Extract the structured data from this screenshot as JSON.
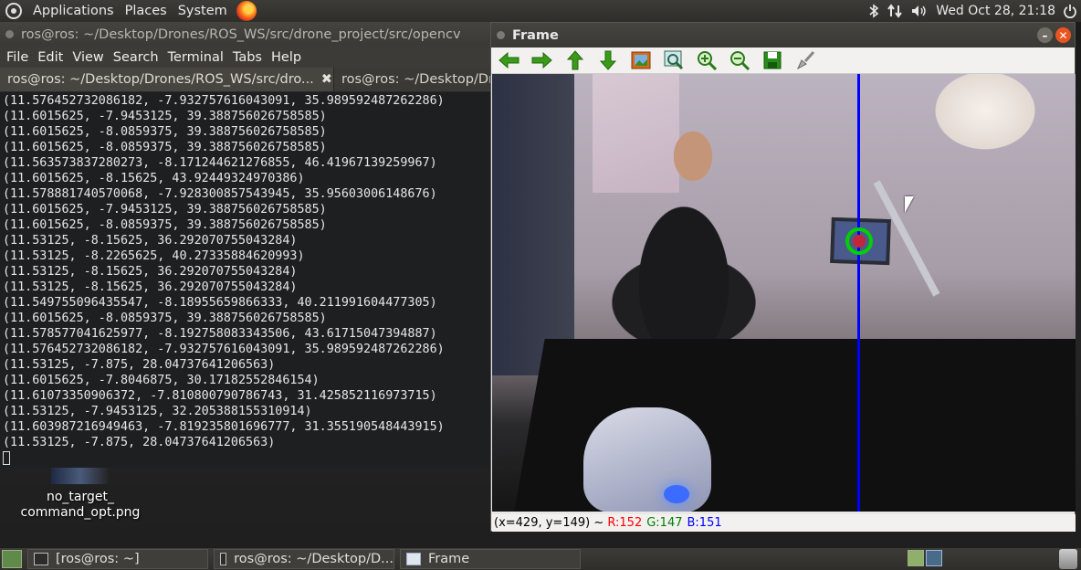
{
  "top_panel": {
    "menus": [
      "Applications",
      "Places",
      "System"
    ],
    "datetime": "Wed Oct 28, 21:18"
  },
  "terminal": {
    "title": "ros@ros: ~/Desktop/Drones/ROS_WS/src/drone_project/src/opencv",
    "menu": [
      "File",
      "Edit",
      "View",
      "Search",
      "Terminal",
      "Tabs",
      "Help"
    ],
    "tabs": [
      {
        "label": "ros@ros: ~/Desktop/Drones/ROS_WS/src/dro...",
        "active": true
      },
      {
        "label": "ros@ros: ~/Desktop/Dr",
        "active": false
      }
    ],
    "lines": [
      "(11.576452732086182, -7.932757616043091, 35.989592487262286)",
      "(11.6015625, -7.9453125, 39.388756026758585)",
      "(11.6015625, -8.0859375, 39.388756026758585)",
      "(11.6015625, -8.0859375, 39.388756026758585)",
      "(11.563573837280273, -8.171244621276855, 46.41967139259967)",
      "(11.6015625, -8.15625, 43.92449324970386)",
      "(11.578881740570068, -7.928300857543945, 35.95603006148676)",
      "(11.6015625, -7.9453125, 39.388756026758585)",
      "(11.6015625, -8.0859375, 39.388756026758585)",
      "(11.53125, -8.15625, 36.292070755043284)",
      "(11.53125, -8.2265625, 40.27335884620993)",
      "(11.53125, -8.15625, 36.292070755043284)",
      "(11.53125, -8.15625, 36.292070755043284)",
      "(11.549755096435547, -8.18955659866333, 40.211991604477305)",
      "(11.6015625, -8.0859375, 39.388756026758585)",
      "(11.578577041625977, -8.192758083343506, 43.61715047394887)",
      "(11.576452732086182, -7.932757616043091, 35.989592487262286)",
      "(11.53125, -7.875, 28.04737641206563)",
      "(11.6015625, -7.8046875, 30.17182552846154)",
      "(11.61073350906372, -7.810800790786743, 31.425852116973715)",
      "(11.53125, -7.9453125, 32.205388155310914)",
      "(11.603987216949463, -7.819235801696777, 31.355190548443915)",
      "(11.53125, -7.875, 28.04737641206563)"
    ]
  },
  "desktop_icon": {
    "line1": "no_target_",
    "line2": "command_opt.png"
  },
  "frame_window": {
    "title": "Frame",
    "status": {
      "coords": "(x=429, y=149)",
      "sep": " ~ ",
      "r": "R:152",
      "g": "G:147",
      "b": "B:151"
    }
  },
  "taskbar": {
    "tasks": [
      "[ros@ros: ~]",
      "ros@ros: ~/Desktop/D...",
      "Frame"
    ]
  },
  "colors": {
    "accent": "#e95420",
    "status_r": "#ff0000",
    "status_g": "#008000",
    "status_b": "#0000ff",
    "tracking_line": "#0000ff",
    "target_ring": "#00d000"
  }
}
